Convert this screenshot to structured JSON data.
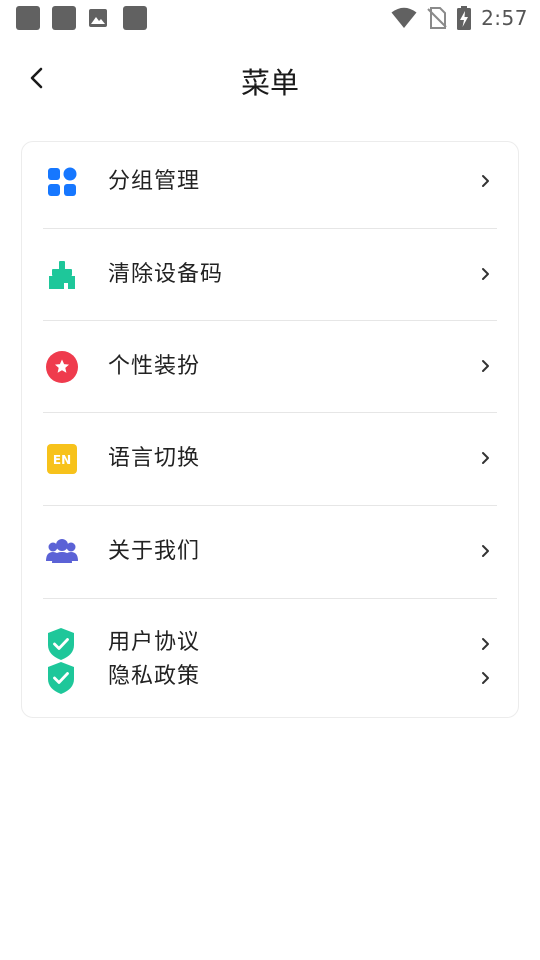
{
  "status_bar": {
    "time": "2:57",
    "icons": [
      "notification-square-icon",
      "notification-square-icon",
      "image-icon",
      "notification-square-icon",
      "wifi-icon",
      "no-sim-icon",
      "battery-charging-icon"
    ]
  },
  "header": {
    "title": "菜单",
    "back_icon": "chevron-left-icon"
  },
  "menu": {
    "items": [
      {
        "label": "分组管理",
        "icon": "grid-apps-icon",
        "color": "#1677ff"
      },
      {
        "label": "清除设备码",
        "icon": "broom-icon",
        "color": "#1ec79a"
      },
      {
        "label": "个性装扮",
        "icon": "star-badge-icon",
        "color": "#ef3b4d"
      },
      {
        "label": "语言切换",
        "icon": "en-language-icon",
        "color": "#f7c21b"
      },
      {
        "label": "关于我们",
        "icon": "people-group-icon",
        "color": "#5b62d6"
      }
    ],
    "legal_items": [
      {
        "label": "用户协议",
        "icon": "shield-check-icon",
        "color": "#1ec79a"
      },
      {
        "label": "隐私政策",
        "icon": "shield-check-icon",
        "color": "#1ec79a"
      }
    ]
  }
}
